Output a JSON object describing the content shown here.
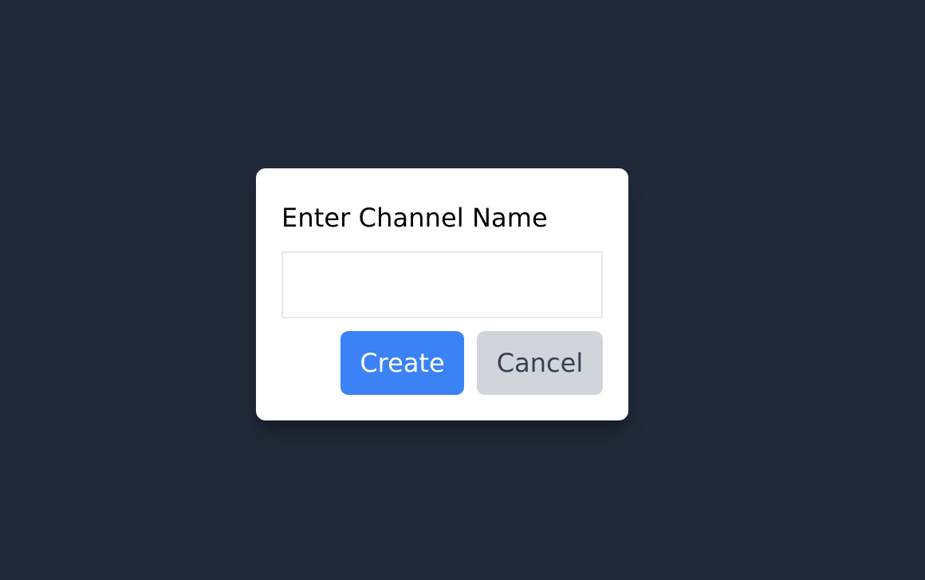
{
  "modal": {
    "title": "Enter Channel Name",
    "input": {
      "value": "",
      "placeholder": ""
    },
    "buttons": {
      "create_label": "Create",
      "cancel_label": "Cancel"
    }
  },
  "colors": {
    "background": "#202938",
    "modal_background": "#ffffff",
    "primary_button": "#3b82f6",
    "secondary_button": "#d1d5db",
    "secondary_button_text": "#374151",
    "input_border": "#e5e7eb"
  }
}
